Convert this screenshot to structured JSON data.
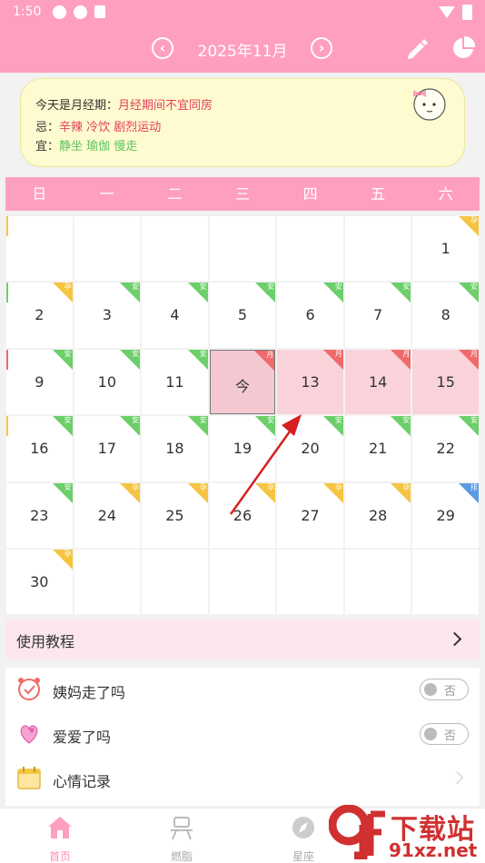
{
  "status_bar": {
    "time": "1:50"
  },
  "header": {
    "month_title": "2025年11月",
    "prev_glyph": "‹",
    "next_glyph": "›"
  },
  "tips": {
    "today_label": "今天是月经期：",
    "today_value": "月经期间不宜同房",
    "avoid_label": "忌：",
    "avoid_value": "辛辣 冷饮 剧烈运动",
    "suitable_label": "宜：",
    "suitable_value": "静坐 瑜伽 慢走"
  },
  "weekdays": [
    "日",
    "一",
    "二",
    "三",
    "四",
    "五",
    "六"
  ],
  "colors": {
    "accent": "#ff9fbf",
    "tag_yellow": "#f5c542",
    "tag_green": "#6ccf6a",
    "tag_red": "#ef6a6a",
    "tag_blue": "#5a9ae0",
    "period_bg": "#f9d2da"
  },
  "calendar": {
    "cells": [
      {
        "n": "",
        "tag": "",
        "bar": "yellow"
      },
      {
        "n": "",
        "tag": ""
      },
      {
        "n": "",
        "tag": ""
      },
      {
        "n": "",
        "tag": ""
      },
      {
        "n": "",
        "tag": ""
      },
      {
        "n": "",
        "tag": ""
      },
      {
        "n": "1",
        "tag": "孕",
        "tc": "yellow"
      },
      {
        "n": "2",
        "tag": "孕",
        "tc": "yellow",
        "bar": "green"
      },
      {
        "n": "3",
        "tag": "安",
        "tc": "green"
      },
      {
        "n": "4",
        "tag": "安",
        "tc": "green"
      },
      {
        "n": "5",
        "tag": "安",
        "tc": "green"
      },
      {
        "n": "6",
        "tag": "安",
        "tc": "green"
      },
      {
        "n": "7",
        "tag": "安",
        "tc": "green"
      },
      {
        "n": "8",
        "tag": "安",
        "tc": "green"
      },
      {
        "n": "9",
        "tag": "安",
        "tc": "green",
        "bar": "red"
      },
      {
        "n": "10",
        "tag": "安",
        "tc": "green"
      },
      {
        "n": "11",
        "tag": "安",
        "tc": "green"
      },
      {
        "n": "今",
        "tag": "月",
        "tc": "red",
        "state": "today"
      },
      {
        "n": "13",
        "tag": "月",
        "tc": "red",
        "state": "period"
      },
      {
        "n": "14",
        "tag": "月",
        "tc": "red",
        "state": "period"
      },
      {
        "n": "15",
        "tag": "月",
        "tc": "red",
        "state": "period"
      },
      {
        "n": "16",
        "tag": "安",
        "tc": "green",
        "bar": "yellow"
      },
      {
        "n": "17",
        "tag": "安",
        "tc": "green"
      },
      {
        "n": "18",
        "tag": "安",
        "tc": "green"
      },
      {
        "n": "19",
        "tag": "安",
        "tc": "green"
      },
      {
        "n": "20",
        "tag": "安",
        "tc": "green"
      },
      {
        "n": "21",
        "tag": "安",
        "tc": "green"
      },
      {
        "n": "22",
        "tag": "安",
        "tc": "green"
      },
      {
        "n": "23",
        "tag": "安",
        "tc": "green"
      },
      {
        "n": "24",
        "tag": "孕",
        "tc": "yellow"
      },
      {
        "n": "25",
        "tag": "孕",
        "tc": "yellow"
      },
      {
        "n": "26",
        "tag": "孕",
        "tc": "yellow"
      },
      {
        "n": "27",
        "tag": "孕",
        "tc": "yellow"
      },
      {
        "n": "28",
        "tag": "孕",
        "tc": "yellow"
      },
      {
        "n": "29",
        "tag": "排",
        "tc": "blue"
      },
      {
        "n": "30",
        "tag": "孕",
        "tc": "yellow"
      },
      {
        "n": "",
        "tag": ""
      },
      {
        "n": "",
        "tag": ""
      },
      {
        "n": "",
        "tag": ""
      },
      {
        "n": "",
        "tag": ""
      },
      {
        "n": "",
        "tag": ""
      },
      {
        "n": "",
        "tag": ""
      }
    ]
  },
  "tutorial": {
    "label": "使用教程"
  },
  "options": [
    {
      "label": "姨妈走了吗",
      "icon": "alarm-check-icon",
      "toggle": "否"
    },
    {
      "label": "爱爱了吗",
      "icon": "hearts-icon",
      "toggle": "否"
    },
    {
      "label": "心情记录",
      "icon": "calendar-note-icon"
    }
  ],
  "nav": [
    {
      "label": "首页",
      "icon": "home-icon",
      "active": true
    },
    {
      "label": "燃脂",
      "icon": "exercise-icon"
    },
    {
      "label": "星座",
      "icon": "compass-icon"
    },
    {
      "label": "",
      "icon": "more-icon"
    }
  ],
  "watermark": {
    "big": "下载站",
    "small": "91xz.net",
    "logo": "9f-logo"
  }
}
